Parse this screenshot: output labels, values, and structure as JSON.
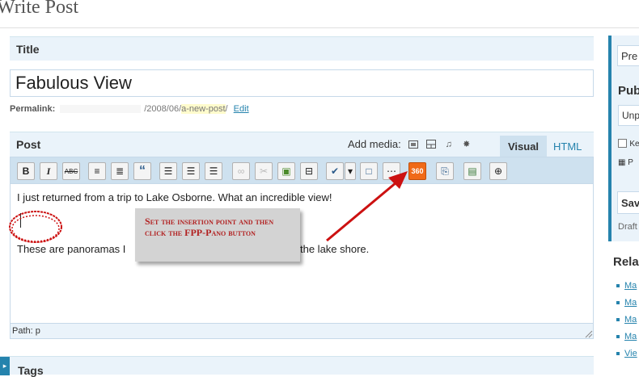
{
  "page": {
    "title": "Write Post"
  },
  "title_box": {
    "heading": "Title",
    "value": "Fabulous View"
  },
  "permalink": {
    "label": "Permalink:",
    "path": "/2008/06/",
    "slug": "a-new-post",
    "after": "/",
    "edit": "Edit"
  },
  "post_box": {
    "heading": "Post",
    "add_media": "Add media:",
    "tab_visual": "Visual",
    "tab_html": "HTML"
  },
  "media_icons": [
    "image-icon",
    "video-icon",
    "audio-icon",
    "media-icon"
  ],
  "toolbar": [
    {
      "name": "bold-button",
      "glyph": "B"
    },
    {
      "name": "italic-button",
      "glyph": "I"
    },
    {
      "name": "strikethrough-button",
      "glyph": "ABC"
    },
    {
      "name": "bullet-list-button",
      "glyph": "≡"
    },
    {
      "name": "numbered-list-button",
      "glyph": "≣"
    },
    {
      "name": "blockquote-button",
      "glyph": "“"
    },
    {
      "name": "align-left-button",
      "glyph": "☰"
    },
    {
      "name": "align-center-button",
      "glyph": "☰"
    },
    {
      "name": "align-right-button",
      "glyph": "☰"
    },
    {
      "name": "link-button",
      "glyph": "∞"
    },
    {
      "name": "unlink-button",
      "glyph": "✂"
    },
    {
      "name": "insert-image-button",
      "glyph": "▣"
    },
    {
      "name": "more-tag-button",
      "glyph": "⊟"
    },
    {
      "name": "spellcheck-button",
      "glyph": "✔"
    },
    {
      "name": "spellcheck-menu-button",
      "glyph": "▾"
    },
    {
      "name": "fullscreen-button",
      "glyph": "□"
    },
    {
      "name": "kitchen-sink-button",
      "glyph": "⋯"
    },
    {
      "name": "fpp-pano-button",
      "glyph": "360"
    },
    {
      "name": "paste-word-button",
      "glyph": "⎘"
    },
    {
      "name": "insert-media-button",
      "glyph": "▤"
    },
    {
      "name": "insert-embed-button",
      "glyph": "⊕"
    }
  ],
  "editor": {
    "line1": "I just returned from a trip to Lake Osborne. What an incredible view!",
    "line3_start": "These are panoramas I",
    "line3_end": "the lake shore."
  },
  "path_bar": "Path: p",
  "callout": {
    "text": "Set the insertion point and then click the FPP-Pano button"
  },
  "tags": {
    "heading": "Tags"
  },
  "sidebar": {
    "preview": "Pre",
    "publish": "Pub",
    "status_select": "Unp",
    "keep_label": "Ke",
    "post_label": "P",
    "save": "Sav",
    "draft": "Draft"
  },
  "related": {
    "heading": "Rela",
    "items": [
      "Ma",
      "Ma",
      "Ma",
      "Ma",
      "Vie"
    ]
  },
  "colors": {
    "accent": "#2583ad",
    "header_bg": "#eaf3fa",
    "toolbar_bg": "#cee1ef",
    "pano": "#f06a18",
    "annotation": "#cc1111"
  }
}
